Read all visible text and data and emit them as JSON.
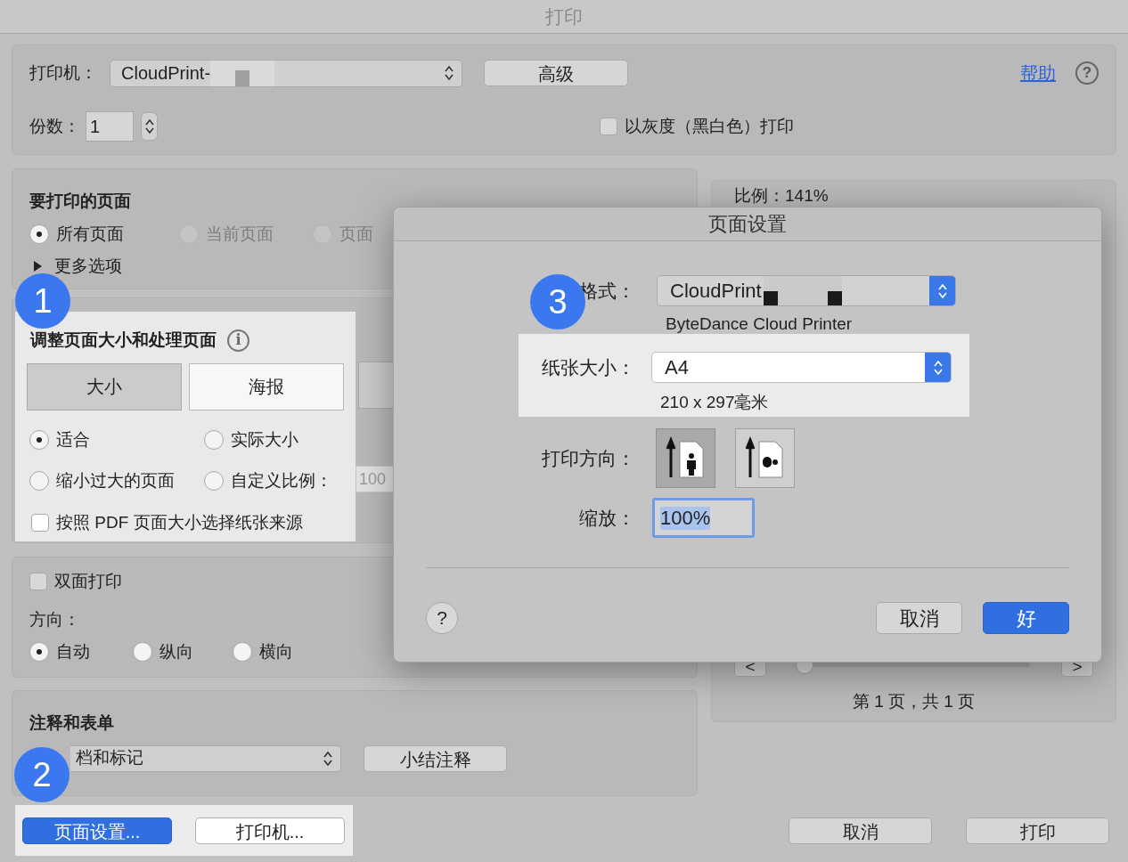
{
  "window": {
    "title": "打印"
  },
  "printer": {
    "label": "打印机：",
    "value": "CloudPrint-",
    "advanced_button": "高级",
    "help_link": "帮助",
    "help_icon": "?"
  },
  "copies": {
    "label": "份数：",
    "value": "1"
  },
  "grayscale": {
    "label": "以灰度（黑白色）打印",
    "checked": false
  },
  "pages_section": {
    "title": "要打印的页面",
    "options": [
      {
        "label": "所有页面",
        "selected": true,
        "disabled": false
      },
      {
        "label": "当前页面",
        "selected": false,
        "disabled": true
      },
      {
        "label": "页面",
        "selected": false,
        "disabled": true
      }
    ],
    "more_options": {
      "label": "更多选项",
      "expanded": false
    }
  },
  "resize_section": {
    "title": "调整页面大小和处理页面",
    "info_icon": "i",
    "tabs": [
      {
        "label": "大小",
        "selected": true
      },
      {
        "label": "海报",
        "selected": false
      }
    ],
    "options": [
      {
        "label": "适合",
        "selected": true
      },
      {
        "label": "实际大小",
        "selected": false
      },
      {
        "label": "缩小过大的页面",
        "selected": false
      },
      {
        "label": "自定义比例：",
        "selected": false
      }
    ],
    "custom_scale": "100",
    "paper_source": {
      "label": "按照 PDF 页面大小选择纸张来源",
      "checked": false
    }
  },
  "duplex": {
    "label": "双面打印",
    "checked": false,
    "orientation_label": "方向：",
    "options": [
      {
        "label": "自动",
        "selected": true
      },
      {
        "label": "纵向",
        "selected": false
      },
      {
        "label": "横向",
        "selected": false
      }
    ]
  },
  "annotations": {
    "title": "注释和表单",
    "select": "档和标记",
    "summary_button": "小结注释"
  },
  "bottom_buttons": [
    {
      "label": "页面设置...",
      "kind": "primary"
    },
    {
      "label": "打印机...",
      "kind": "default"
    }
  ],
  "preview": {
    "scale": "比例：141%",
    "prev": "<",
    "next": ">",
    "page_slider": {
      "level": 0.03
    },
    "page_info": "第 1 页，共 1 页"
  },
  "actions": [
    {
      "label": "取消",
      "kind": "default"
    },
    {
      "label": "打印",
      "kind": "default"
    }
  ],
  "page_setup_dialog": {
    "title": "页面设置",
    "format_label": "格式：",
    "format_value": "CloudPrint",
    "format_note": "ByteDance Cloud Printer",
    "paper_label": "纸张大小：",
    "paper_value": "A4",
    "paper_note": "210 x 297毫米",
    "orientation_label": "打印方向：",
    "orientations": [
      {
        "kind": "portrait",
        "selected": true
      },
      {
        "kind": "landscape",
        "selected": false
      }
    ],
    "scale_label": "缩放：",
    "scale_value": "100%",
    "help": "?",
    "buttons": [
      {
        "label": "取消",
        "kind": "default"
      },
      {
        "label": "好",
        "kind": "primary"
      }
    ]
  },
  "callouts": [
    "1",
    "2",
    "3"
  ]
}
